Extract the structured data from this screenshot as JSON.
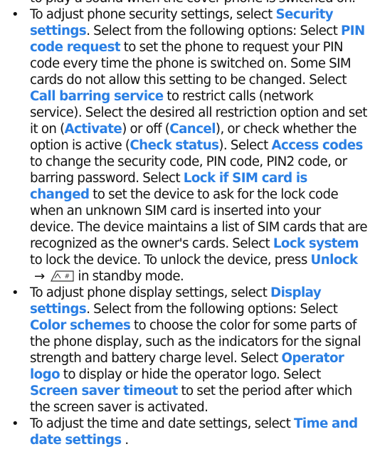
{
  "cut_line": "to play a sound when the cover phone is switched on.",
  "items": [
    {
      "s1": "To adjust phone security settings, select ",
      "security_settings": "Security settings",
      "s2": ". Select from the following options: Select ",
      "pin_code_request": "PIN code request",
      "s3": " to set the phone to request your PIN code every time the phone is switched on. Some SIM cards do not allow this setting to be changed. Select ",
      "call_barring_service": "Call barring service",
      "s4": " to restrict calls (network service). Select the desired all restriction option and set it on (",
      "activate": "Activate",
      "s5": ") or off (",
      "cancel": "Cancel",
      "s6": "), or check whether the option is active (",
      "check_status": "Check status",
      "s7": "). Select ",
      "access_codes": "Access codes",
      "s8": " to change the security code, PIN code, PIN2 code, or barring password. Select ",
      "lock_if_sim": "Lock if SIM card is changed",
      "s9": " to set the device to ask for the lock code when an unknown SIM card is inserted into your device. The device maintains a list of SIM cards that are recognized as the owner's cards. Select ",
      "lock_system": "Lock system",
      "s10": " to lock the device. To unlock the device, press ",
      "unlock": "Unlock",
      "arrow": "→",
      "key_label": "#",
      "s11": " in standby mode."
    },
    {
      "s1": "To adjust phone display settings, select ",
      "display_settings": "Display settings",
      "s2": ". Select from the following options: Select ",
      "color_schemes": "Color schemes",
      "s3": " to choose the color for some parts of the phone display, such as the indicators for the signal strength and battery charge level. Select ",
      "operator_logo": "Operator logo",
      "s4": " to display or hide the operator logo. Select ",
      "screen_saver_timeout": "Screen saver timeout",
      "s5": " to set the period after which the screen saver is activated."
    },
    {
      "s1": "To adjust the time and date settings, select ",
      "time_and_date_settings": "Time and date settings",
      "s2": " ."
    }
  ],
  "colors": {
    "keyword": "#2a7fe4",
    "text": "#111111"
  },
  "icons": {
    "key": "key-hash-icon",
    "arrow": "arrow-right-icon"
  }
}
